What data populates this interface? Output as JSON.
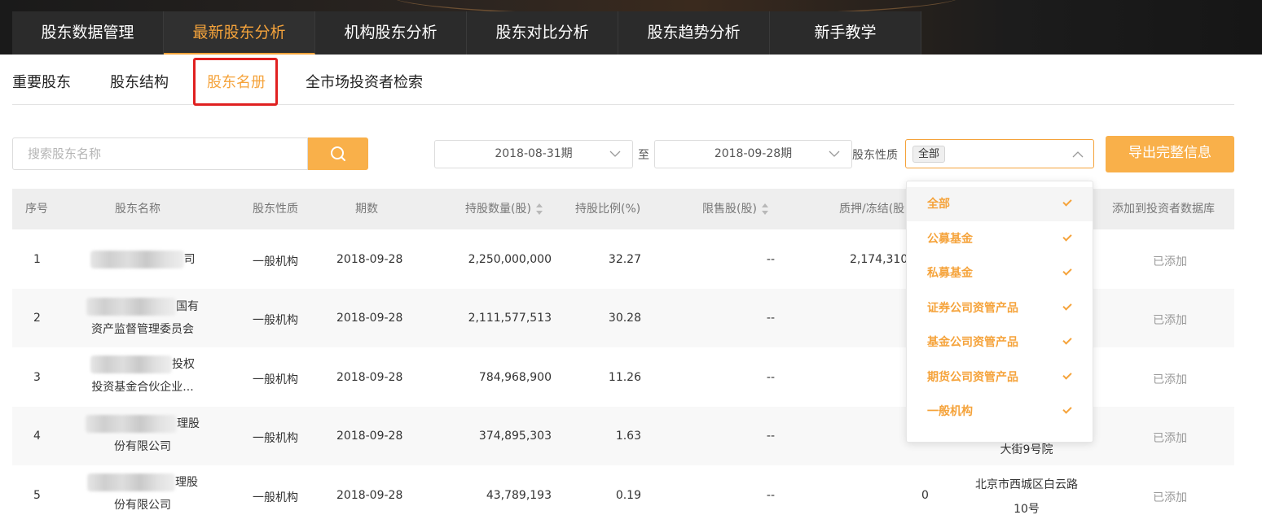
{
  "nav": {
    "tabs": [
      {
        "label": "股东数据管理"
      },
      {
        "label": "最新股东分析"
      },
      {
        "label": "机构股东分析"
      },
      {
        "label": "股东对比分析"
      },
      {
        "label": "股东趋势分析"
      },
      {
        "label": "新手教学"
      }
    ],
    "active_index": 1
  },
  "subnav": {
    "tabs": [
      {
        "label": "重要股东"
      },
      {
        "label": "股东结构"
      },
      {
        "label": "股东名册"
      },
      {
        "label": "全市场投资者检索"
      }
    ],
    "active_index": 2
  },
  "filters": {
    "search_placeholder": "搜索股东名称",
    "search_icon": "search-icon",
    "date_from": "2018-08-31期",
    "date_to": "2018-09-28期",
    "date_sep": "至",
    "nature_label": "股东性质",
    "nature_selected": "全部",
    "export_label": "导出完整信息"
  },
  "table": {
    "headers": {
      "index": "序号",
      "name": "股东名称",
      "nature": "股东性质",
      "period": "期数",
      "shares": "持股数量(股)",
      "ratio": "持股比例(%)",
      "restricted": "限售股(股)",
      "pledged": "质押/冻结(股",
      "add": "添加到投资者数据库"
    },
    "rows": [
      {
        "index": "1",
        "name_l1": "司",
        "name_l2": "",
        "nature": "一般机构",
        "period": "2018-09-28",
        "shares": "2,250,000,000",
        "ratio": "32.27",
        "restricted": "--",
        "pledged": "2,174,310",
        "address_l1": "",
        "address_l2": "",
        "status": "已添加"
      },
      {
        "index": "2",
        "name_l1": "国有",
        "name_l2": "资产监督管理委员会",
        "nature": "一般机构",
        "period": "2018-09-28",
        "shares": "2,111,577,513",
        "ratio": "30.28",
        "restricted": "--",
        "pledged": "",
        "address_l1": "",
        "address_l2": "",
        "status": "已添加"
      },
      {
        "index": "3",
        "name_l1": "投权",
        "name_l2": "投资基金合伙企业...",
        "nature": "一般机构",
        "period": "2018-09-28",
        "shares": "784,968,900",
        "ratio": "11.26",
        "restricted": "--",
        "pledged": "",
        "address_l1": "",
        "address_l2": "",
        "status": "已添加"
      },
      {
        "index": "4",
        "name_l1": "理股",
        "name_l2": "份有限公司",
        "nature": "一般机构",
        "period": "2018-09-28",
        "shares": "374,895,303",
        "ratio": "1.63",
        "restricted": "--",
        "pledged": "",
        "address_l1": "",
        "address_l2": "大街9号院",
        "status": "已添加"
      },
      {
        "index": "5",
        "name_l1": "理股",
        "name_l2": "份有限公司",
        "nature": "一般机构",
        "period": "2018-09-28",
        "shares": "43,789,193",
        "ratio": "0.19",
        "restricted": "--",
        "pledged": "0",
        "address_l1": "北京市西城区白云路",
        "address_l2": "10号",
        "status": "已添加"
      }
    ]
  },
  "dropdown": {
    "options": [
      {
        "label": "全部"
      },
      {
        "label": "公募基金"
      },
      {
        "label": "私募基金"
      },
      {
        "label": "证券公司资管产品"
      },
      {
        "label": "基金公司资管产品"
      },
      {
        "label": "期货公司资管产品"
      },
      {
        "label": "一般机构"
      }
    ]
  },
  "colors": {
    "accent": "#f5a33b",
    "highlight": "#e02020"
  }
}
